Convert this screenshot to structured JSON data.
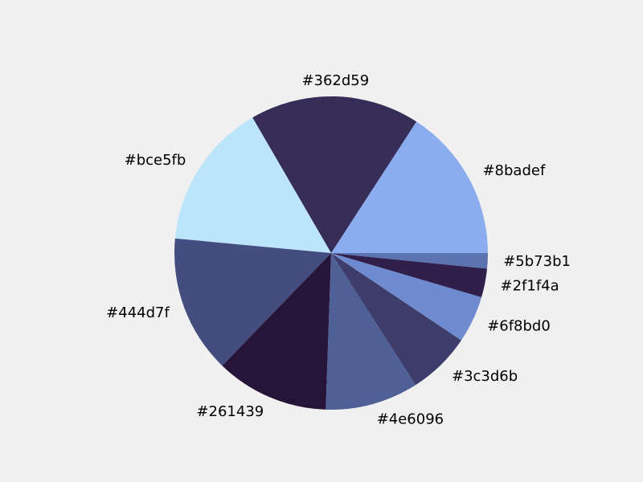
{
  "chart_data": {
    "type": "pie",
    "title": "",
    "start_angle_deg": 0,
    "direction": "counterclockwise",
    "background": "#f0f0f0",
    "slices": [
      {
        "label": "#8badef",
        "color": "#8badef",
        "value": 16.0
      },
      {
        "label": "#362d59",
        "color": "#362d59",
        "value": 17.7
      },
      {
        "label": "#bce5fb",
        "color": "#bce5fb",
        "value": 15.3
      },
      {
        "label": "#444d7f",
        "color": "#444d7f",
        "value": 14.4
      },
      {
        "label": "#261439",
        "color": "#261439",
        "value": 11.8
      },
      {
        "label": "#4e6096",
        "color": "#4e6096",
        "value": 9.7
      },
      {
        "label": "#3c3d6b",
        "color": "#3c3d6b",
        "value": 6.6
      },
      {
        "label": "#6f8bd0",
        "color": "#6f8bd0",
        "value": 4.9
      },
      {
        "label": "#2f1f4a",
        "color": "#2f1f4a",
        "value": 3.0
      },
      {
        "label": "#5b73b1",
        "color": "#5b73b1",
        "value": 1.6
      }
    ]
  }
}
